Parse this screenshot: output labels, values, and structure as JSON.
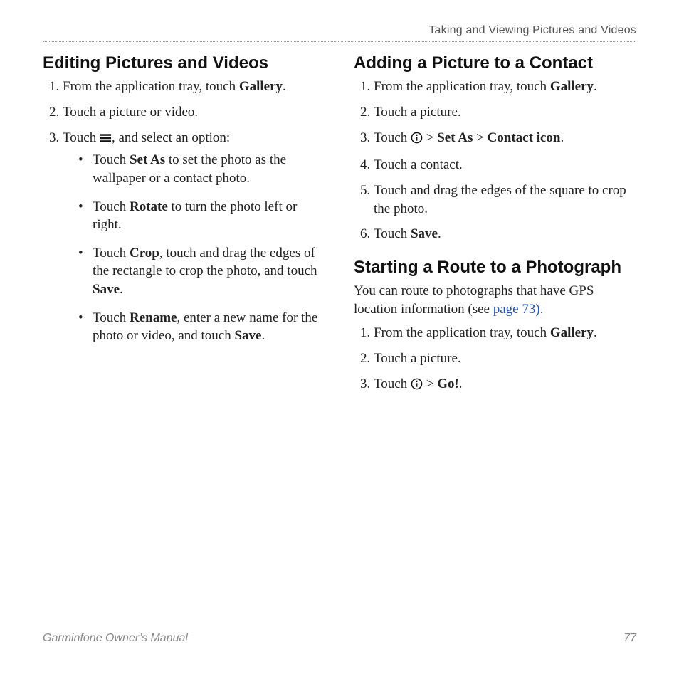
{
  "header": {
    "section_title": "Taking and Viewing Pictures and Videos"
  },
  "left": {
    "h1": "Editing Pictures and Videos",
    "s1_a": "From the application tray, touch ",
    "s1_b": "Gallery",
    "s1_c": ".",
    "s2": "Touch a picture or video.",
    "s3_a": "Touch ",
    "s3_b": ", and select an option:",
    "b1_a": "Touch ",
    "b1_b": "Set As",
    "b1_c": " to set the photo as the wallpaper or a contact photo.",
    "b2_a": "Touch ",
    "b2_b": "Rotate",
    "b2_c": " to turn the photo left or right.",
    "b3_a": "Touch ",
    "b3_b": "Crop",
    "b3_c": ", touch and drag the edges of the rectangle to crop the photo, and touch ",
    "b3_d": "Save",
    "b3_e": ".",
    "b4_a": "Touch ",
    "b4_b": "Rename",
    "b4_c": ", enter a new name for the photo or video, and touch ",
    "b4_d": "Save",
    "b4_e": "."
  },
  "right": {
    "h1": "Adding a Picture to a Contact",
    "a1_a": "From the application tray, touch ",
    "a1_b": "Gallery",
    "a1_c": ".",
    "a2": "Touch a picture.",
    "a3_a": "Touch ",
    "a3_b": " > ",
    "a3_c": "Set As",
    "a3_d": " > ",
    "a3_e": "Contact icon",
    "a3_f": ".",
    "a4": "Touch a contact.",
    "a5": "Touch and drag the edges of the square to crop the photo.",
    "a6_a": "Touch ",
    "a6_b": "Save",
    "a6_c": ".",
    "h2": "Starting a Route to a Photograph",
    "p1_a": "You can route to photographs that have GPS location information (see ",
    "p1_link": "page 73)",
    "p1_c": ".",
    "r1_a": "From the application tray, touch ",
    "r1_b": "Gallery",
    "r1_c": ".",
    "r2": "Touch a picture.",
    "r3_a": "Touch ",
    "r3_b": " > ",
    "r3_c": "Go!",
    "r3_d": "."
  },
  "footer": {
    "manual": "Garminfone Owner’s Manual",
    "page": "77"
  }
}
